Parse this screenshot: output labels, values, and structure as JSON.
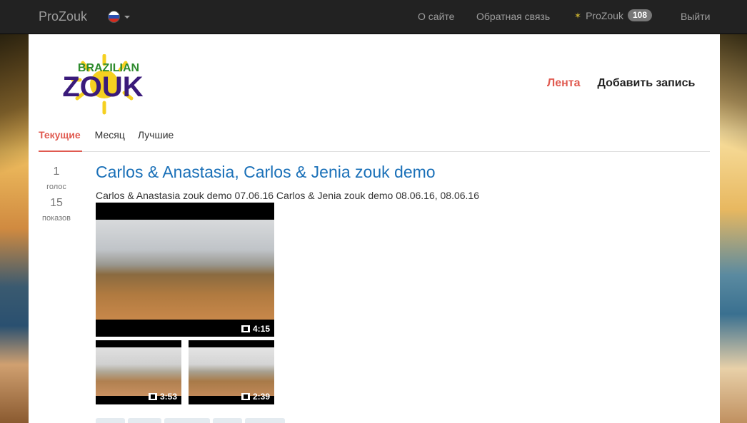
{
  "navbar": {
    "brand": "ProZouk",
    "links": {
      "about": "О сайте",
      "feedback": "Обратная связь",
      "user": "ProZouk",
      "user_badge": "108",
      "logout": "Выйти"
    }
  },
  "logo": {
    "line1": "BRAZILIAN",
    "line2": "ZOUK"
  },
  "top_tabs": {
    "feed": "Лента",
    "add": "Добавить запись"
  },
  "sub_tabs": {
    "current": "Текущие",
    "month": "Месяц",
    "best": "Лучшие"
  },
  "post": {
    "votes": "1",
    "votes_label": "голос",
    "views": "15",
    "views_label": "показов",
    "title": "Carlos & Anastasia, Carlos & Jenia zouk demo",
    "description": "Carlos & Anastasia zouk demo 07.06.16 Carlos & Jenia zouk demo 08.06.16, 08.06.16",
    "videos": {
      "main_duration": "4:15",
      "second_duration": "3:53",
      "third_duration": "2:39"
    }
  },
  "colors": {
    "navbar_bg": "#222222",
    "accent": "#e05a50",
    "link": "#1a70b8",
    "badge": "#777777"
  }
}
